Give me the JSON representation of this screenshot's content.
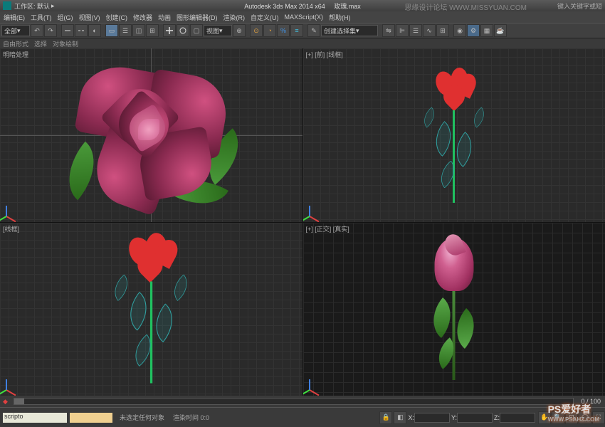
{
  "title": {
    "workspace_label": "工作区: 默认",
    "app": "Autodesk 3ds Max  2014 x64",
    "file": "玫瑰.max",
    "help_hint": "键入关键字或短",
    "forum": "思缘设计论坛  WWW.MISSYUAN.COM"
  },
  "menu": {
    "edit": "编辑(E)",
    "tools": "工具(T)",
    "group": "组(G)",
    "views": "视图(V)",
    "create": "创建(C)",
    "modifiers": "修改器",
    "animation": "动画",
    "graph": "图形编辑器(D)",
    "render": "渲染(R)",
    "custom": "自定义(U)",
    "maxscript": "MAXScript(X)",
    "help": "帮助(H)"
  },
  "toolbar": {
    "all": "全部",
    "view": "视图",
    "selection_set": "创建选择集"
  },
  "tabs": {
    "t1": "自由形式",
    "t2": "选择",
    "t3": "对象绘制"
  },
  "viewports": {
    "tl": "明暗处理",
    "tr": "[+] [前] [线框]",
    "bl": "[线框]",
    "br": "[+] [正交] [真实]"
  },
  "timeline": {
    "range": "0 / 100"
  },
  "status": {
    "script": "scripto",
    "prompt": "",
    "selection": "未选定任何对象",
    "render_label": "渲染时间  0:0",
    "x": "X:",
    "y": "Y:",
    "z": "Z:"
  },
  "watermark": {
    "main": "PS爱好者",
    "url": "WWW.PSAHZ.COM"
  }
}
